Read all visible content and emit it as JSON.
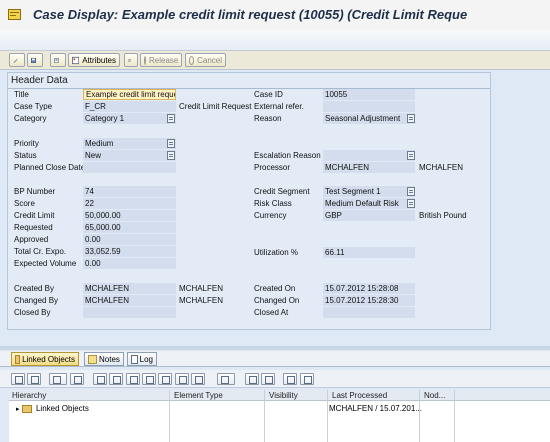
{
  "window": {
    "title": "Case Display: Example credit limit request (10055) (Credit Limit Reque"
  },
  "toolbar": {
    "attributes_label": "Attributes",
    "release_label": "Release",
    "cancel_label": "Cancel"
  },
  "header": {
    "section_title": "Header Data",
    "title_label": "Title",
    "title_value": "Example credit limit reque",
    "case_type_label": "Case Type",
    "case_type_value": "F_CR",
    "case_type_text": "Credit Limit Request",
    "category_label": "Category",
    "category_value": "Category 1",
    "case_id_label": "Case ID",
    "case_id_value": "10055",
    "ext_ref_label": "External refer.",
    "reason_label": "Reason",
    "reason_value": "Seasonal Adjustment",
    "priority_label": "Priority",
    "priority_value": "Medium",
    "status_label": "Status",
    "status_value": "New",
    "planned_close_label": "Planned Close Date",
    "escalation_label": "Escalation Reason",
    "processor_label": "Processor",
    "processor_value": "MCHALFEN",
    "processor_text": "MCHALFEN",
    "bp_label": "BP Number",
    "bp_value": "74",
    "score_label": "Score",
    "score_value": "22",
    "credit_limit_label": "Credit Limit",
    "credit_limit_value": "50,000.00",
    "requested_label": "Requested",
    "requested_value": "65,000.00",
    "approved_label": "Approved",
    "approved_value": "0.00",
    "total_exp_label": "Total Cr. Expo.",
    "total_exp_value": "33,052.59",
    "expected_label": "Expected Volume",
    "expected_value": "0.00",
    "credit_segment_label": "Credit Segment",
    "credit_segment_value": "Test Segment 1",
    "risk_class_label": "Risk Class",
    "risk_class_value": "Medium Default Risk",
    "currency_label": "Currency",
    "currency_value": "GBP",
    "currency_text": "British Pound",
    "utilization_label": "Utilization %",
    "utilization_value": "66.11",
    "created_by_label": "Created By",
    "created_by_value": "MCHALFEN",
    "created_by_text": "MCHALFEN",
    "changed_by_label": "Changed By",
    "changed_by_value": "MCHALFEN",
    "changed_by_text": "MCHALFEN",
    "closed_by_label": "Closed By",
    "created_on_label": "Created On",
    "created_on_value": "15.07.2012 15:28:08",
    "changed_on_label": "Changed On",
    "changed_on_value": "15.07.2012 15:28:30",
    "closed_at_label": "Closed At"
  },
  "tabs": {
    "linked_objects": "Linked Objects",
    "notes": "Notes",
    "log": "Log"
  },
  "tree": {
    "columns": [
      "Hierarchy",
      "Element Type",
      "Visibility",
      "Last Processed",
      "Nod..."
    ],
    "rows": [
      {
        "hierarchy": "Linked Objects",
        "element_type": "",
        "visibility": "",
        "last_processed": "MCHALFEN / 15.07.201...",
        "node": ""
      }
    ]
  },
  "colors": {
    "background": "#dfe9f5",
    "editable_field": "#fff3c4",
    "display_field": "#d3dded",
    "active_tab": "#f2dc84"
  }
}
